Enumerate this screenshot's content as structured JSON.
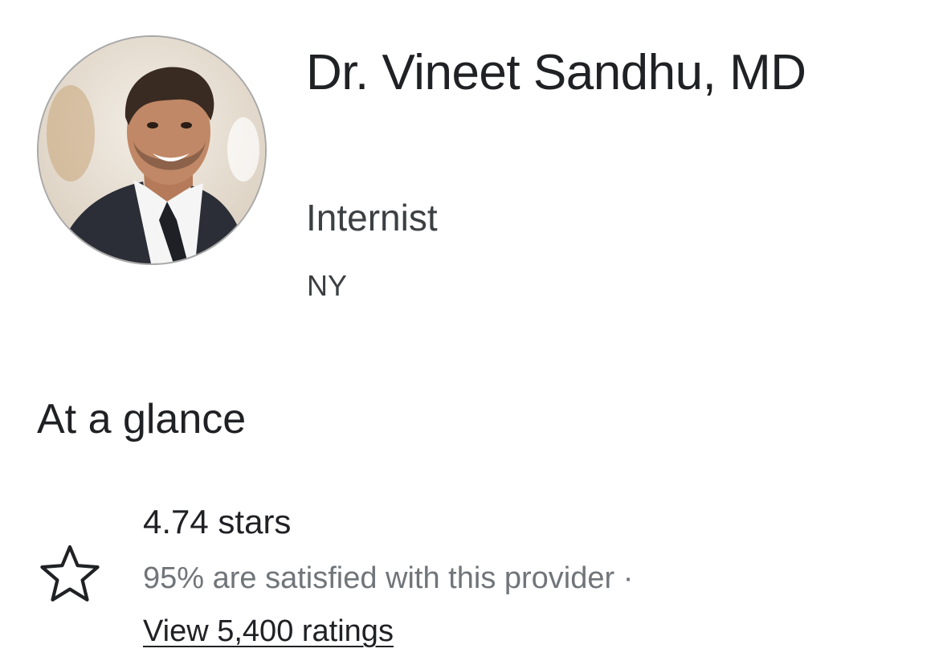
{
  "provider": {
    "name": "Dr. Vineet Sandhu, MD",
    "specialty": "Internist",
    "location": "NY",
    "avatar_icon": "person-photo"
  },
  "glance": {
    "title": "At a glance",
    "rating_value": 4.74,
    "rating_text": "4.74 stars",
    "satisfaction_text": "95% are satisfied with this provider ·",
    "ratings_link_text": "View 5,400 ratings",
    "icon": "star-outline-icon"
  },
  "colors": {
    "primary_text": "#202124",
    "secondary_text": "#70757a",
    "avatar_border": "#a8a8a8"
  }
}
